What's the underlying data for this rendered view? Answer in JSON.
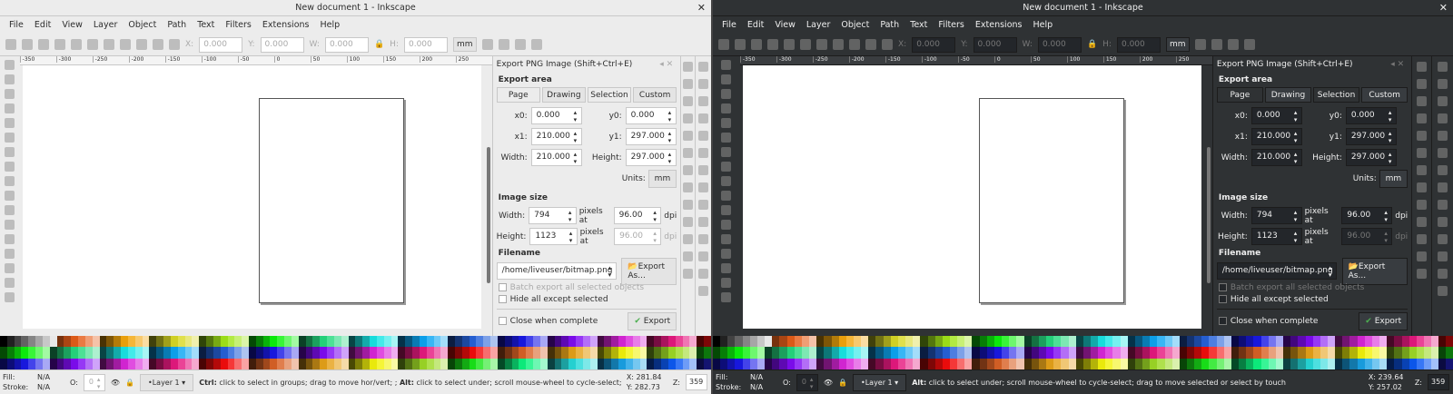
{
  "windows": [
    {
      "theme": "light",
      "title": "New document 1 - Inkscape",
      "menu": [
        "File",
        "Edit",
        "View",
        "Layer",
        "Object",
        "Path",
        "Text",
        "Filters",
        "Extensions",
        "Help"
      ],
      "toolbar": {
        "x_label": "X:",
        "x": "0.000",
        "y_label": "Y:",
        "y": "0.000",
        "w_label": "W:",
        "w": "0.000",
        "h_label": "H:",
        "h": "0.000",
        "units": "mm"
      },
      "ruler": [
        "-350",
        "-300",
        "-250",
        "-200",
        "-150",
        "-100",
        "-50",
        "0",
        "50",
        "100",
        "150",
        "200",
        "250"
      ],
      "export": {
        "title": "Export PNG Image (Shift+Ctrl+E)",
        "area_label": "Export area",
        "tabs": [
          "Page",
          "Drawing",
          "Selection",
          "Custom"
        ],
        "x0_label": "x0:",
        "x0": "0.000",
        "y0_label": "y0:",
        "y0": "0.000",
        "x1_label": "x1:",
        "x1": "210.000",
        "y1_label": "y1:",
        "y1": "297.000",
        "width_label": "Width:",
        "width": "210.000",
        "height_label": "Height:",
        "height": "297.000",
        "units_label": "Units:",
        "units": "mm",
        "image_size_label": "Image size",
        "img_width_label": "Width:",
        "img_width": "794",
        "img_height_label": "Height:",
        "img_height": "1123",
        "pixels_at": "pixels at",
        "dpi_x": "96.00",
        "dpi_y": "96.00",
        "dpi": "dpi",
        "filename_label": "Filename",
        "filename": "/home/liveuser/bitmap.png",
        "export_as": "Export As...",
        "batch": "Batch export all selected objects",
        "hide": "Hide all except selected",
        "close_when": "Close when complete",
        "export": "Export"
      },
      "status": {
        "fill_label": "Fill:",
        "fill": "N/A",
        "stroke_label": "Stroke:",
        "stroke": "N/A",
        "opacity_label": "O:",
        "opacity": "0",
        "layer": "•Layer 1",
        "msg_bold1": "Ctrl:",
        "msg1": " click to select in groups; drag to move hor/vert; ; ",
        "msg_bold2": "Alt:",
        "msg2": " click to select under; scroll mouse-wheel to cycle-select; drag to move selec...",
        "x": "X: 281.84",
        "y": "Y: 282.73",
        "zoom_label": "Z:",
        "zoom": "359"
      }
    },
    {
      "theme": "dark",
      "title": "New document 1 - Inkscape",
      "menu": [
        "File",
        "Edit",
        "View",
        "Layer",
        "Object",
        "Path",
        "Text",
        "Filters",
        "Extensions",
        "Help"
      ],
      "toolbar": {
        "x_label": "X:",
        "x": "0.000",
        "y_label": "Y:",
        "y": "0.000",
        "w_label": "W:",
        "w": "0.000",
        "h_label": "H:",
        "h": "0.000",
        "units": "mm"
      },
      "ruler": [
        "-350",
        "-300",
        "-250",
        "-200",
        "-150",
        "-100",
        "-50",
        "0",
        "50",
        "100",
        "150",
        "200",
        "250"
      ],
      "export": {
        "title": "Export PNG Image (Shift+Ctrl+E)",
        "area_label": "Export area",
        "tabs": [
          "Page",
          "Drawing",
          "Selection",
          "Custom"
        ],
        "x0_label": "x0:",
        "x0": "0.000",
        "y0_label": "y0:",
        "y0": "0.000",
        "x1_label": "x1:",
        "x1": "210.000",
        "y1_label": "y1:",
        "y1": "297.000",
        "width_label": "Width:",
        "width": "210.000",
        "height_label": "Height:",
        "height": "297.000",
        "units_label": "Units:",
        "units": "mm",
        "image_size_label": "Image size",
        "img_width_label": "Width:",
        "img_width": "794",
        "img_height_label": "Height:",
        "img_height": "1123",
        "pixels_at": "pixels at",
        "dpi_x": "96.00",
        "dpi_y": "96.00",
        "dpi": "dpi",
        "filename_label": "Filename",
        "filename": "/home/liveuser/bitmap.png",
        "export_as": "Export As...",
        "batch": "Batch export all selected objects",
        "hide": "Hide all except selected",
        "close_when": "Close when complete",
        "export": "Export"
      },
      "status": {
        "fill_label": "Fill:",
        "fill": "N/A",
        "stroke_label": "Stroke:",
        "stroke": "N/A",
        "opacity_label": "O:",
        "opacity": "0",
        "layer": "•Layer 1",
        "msg_bold1": "",
        "msg1": "",
        "msg_bold2": "Alt:",
        "msg2": " click to select under; scroll mouse-wheel to cycle-select; drag to move selected or select by touch",
        "x": "X: 239.64",
        "y": "Y: 257.02",
        "zoom_label": "Z:",
        "zoom": "359"
      }
    }
  ],
  "colors": {
    "accent_check": "#4caf50",
    "dark_bg": "#2f3234",
    "light_bg": "#ececec"
  }
}
